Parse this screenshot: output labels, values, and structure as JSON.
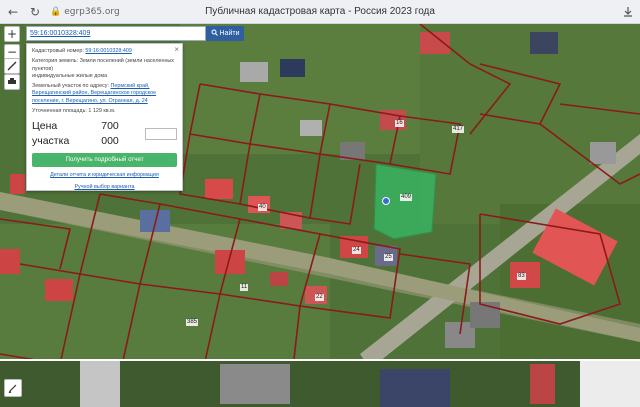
{
  "browser": {
    "back_icon": "arrow-left-icon",
    "reload_icon": "reload-icon",
    "address": "egrp365.org",
    "tab_title": "Публичная кадастровая карта - Россия 2023 года"
  },
  "map": {
    "zoom_in": "+",
    "zoom_out": "−",
    "search": {
      "value": "59:16:0010328:409",
      "button": "Найти"
    },
    "panel": {
      "cad_label": "Кадастровый номер:",
      "cad_value": "59:16:0010328:409",
      "cat_label": "Категория земель:",
      "cat_value": "Земли поселений (земли населенных пунктов)",
      "use_value": "индивидуальные жилые дома",
      "addr_label": "Земельный участок по адресу:",
      "addr_value": "Пермский край, Верещагинский район, Верещагинское городское поселение, г. Верещагино, ул. Огранная, д. 24",
      "area_label": "Уточненная площадь:",
      "area_value": "1 129 кв.м.",
      "price_label": "Цена участка",
      "price_value": "700 000",
      "report_button": "Получить подробный отчет",
      "report_link": "Детали отчета и юридическая информация",
      "manual_link": "Ручной выбор варианта"
    },
    "plot_labels": [
      "409",
      "417",
      "16",
      "40",
      "24",
      "83",
      "25",
      "22",
      "11",
      "385"
    ]
  },
  "colors": {
    "accent_blue": "#2f5fa0",
    "green_button": "#49b56a",
    "parcel_border": "#8b1a1a",
    "selected_parcel": "#2ecc71"
  }
}
